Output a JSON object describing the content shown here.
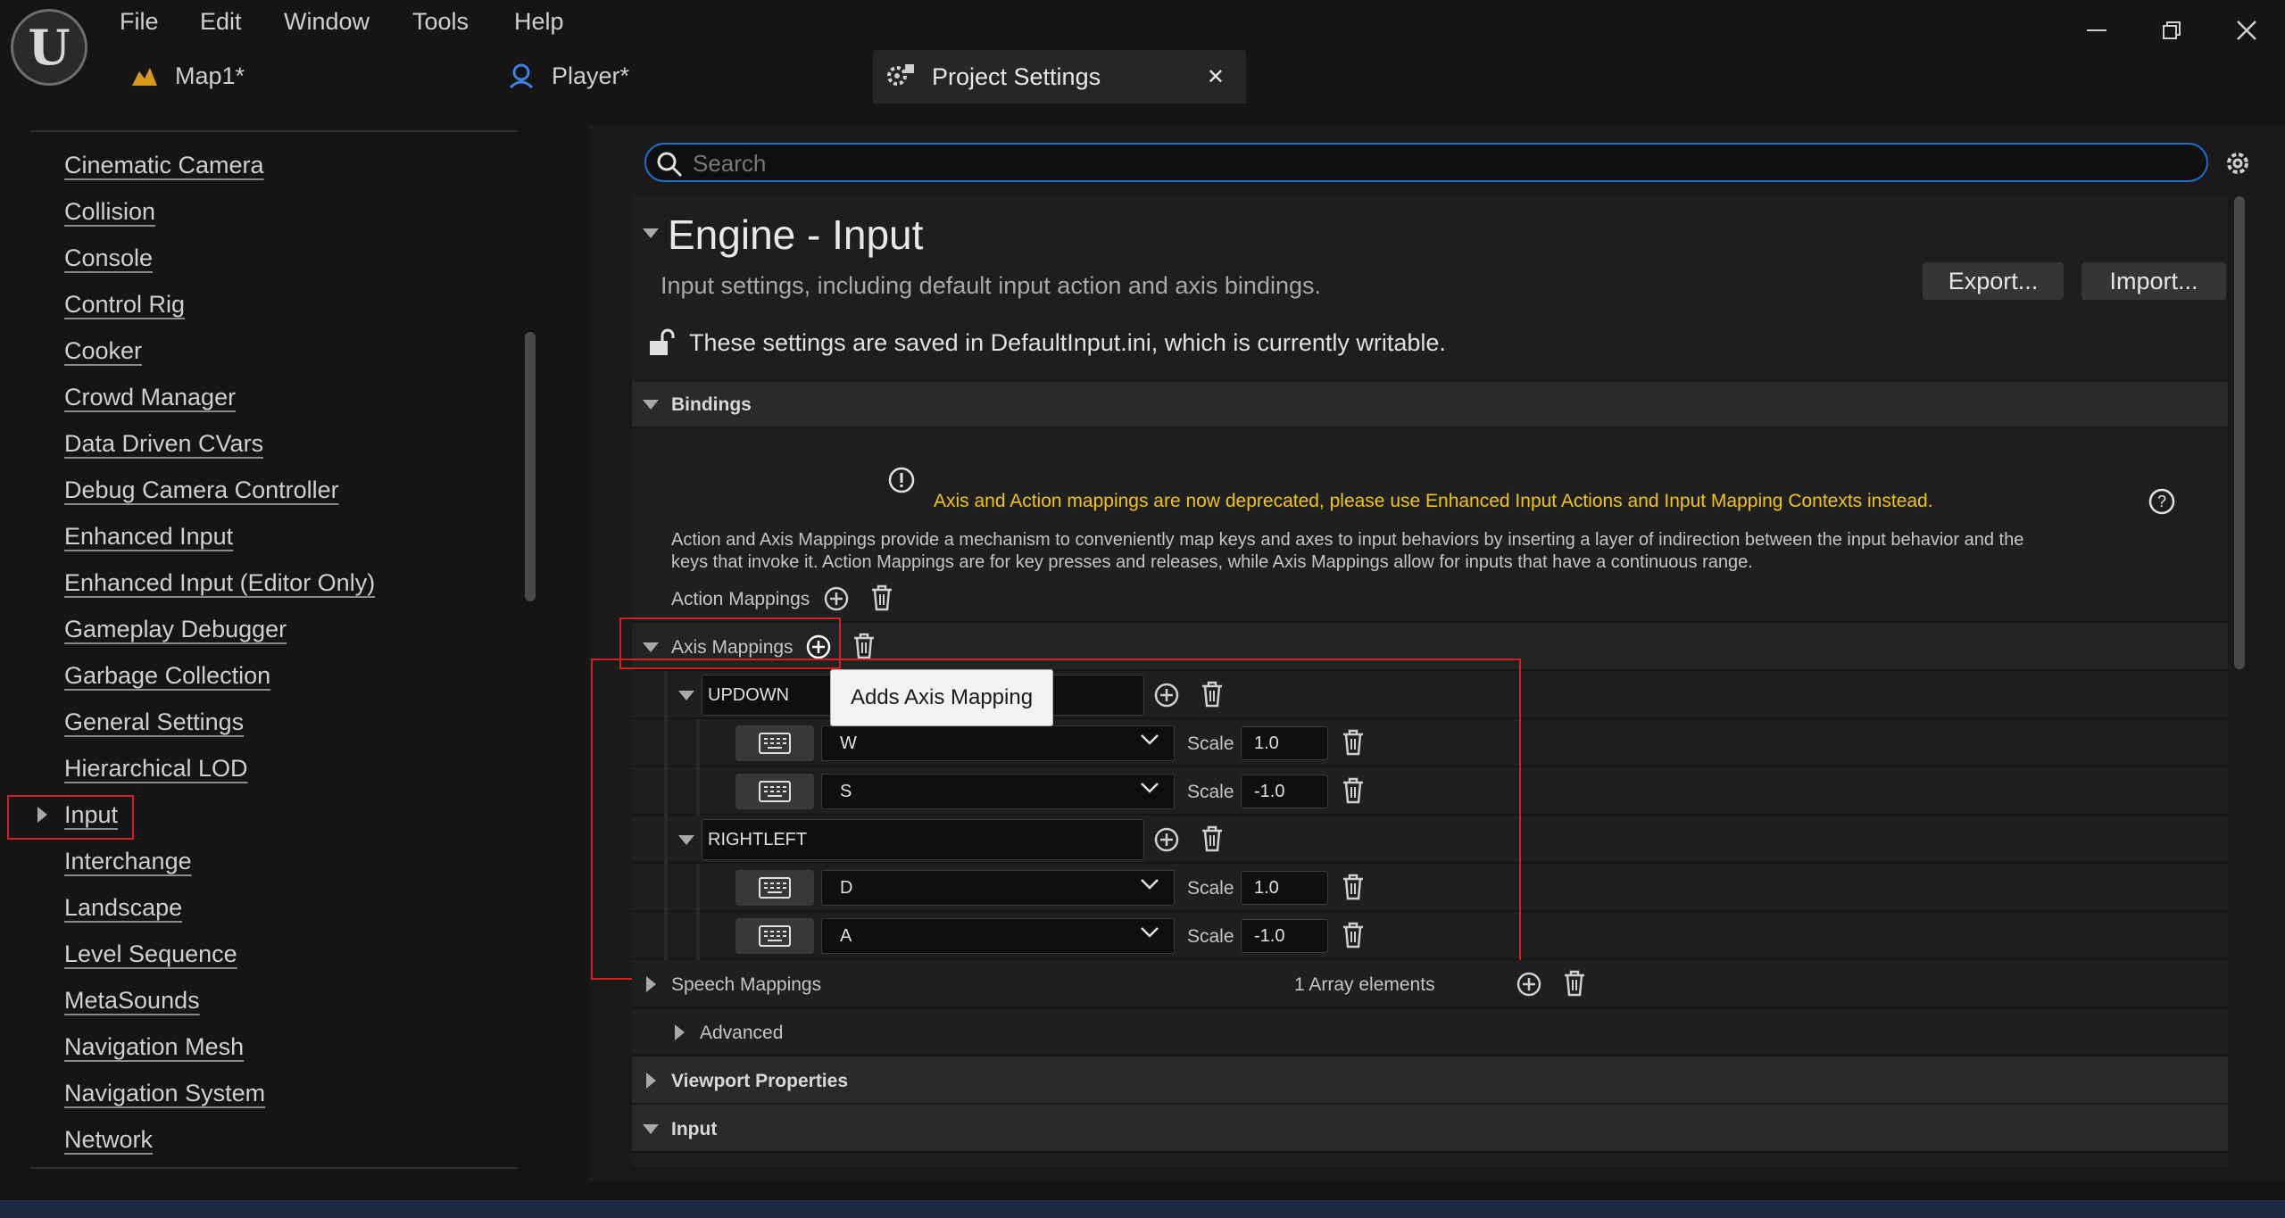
{
  "menu": [
    "File",
    "Edit",
    "Window",
    "Tools",
    "Help"
  ],
  "tabs": {
    "map": "Map1*",
    "player": "Player*",
    "project": "Project Settings"
  },
  "nav": {
    "items": [
      "Cinematic Camera",
      "Collision",
      "Console",
      "Control Rig",
      "Cooker",
      "Crowd Manager",
      "Data Driven CVars",
      "Debug Camera Controller",
      "Enhanced Input",
      "Enhanced Input (Editor Only)",
      "Gameplay Debugger",
      "Garbage Collection",
      "General Settings",
      "Hierarchical LOD",
      "Input",
      "Interchange",
      "Landscape",
      "Level Sequence",
      "MetaSounds",
      "Navigation Mesh",
      "Navigation System",
      "Network"
    ],
    "selected": "Input"
  },
  "search": {
    "placeholder": "Search"
  },
  "header": {
    "title": "Engine - Input",
    "subtitle": "Input settings, including default input action and axis bindings.",
    "export": "Export...",
    "import": "Import...",
    "writable": "These settings are saved in DefaultInput.ini, which is currently writable."
  },
  "bindings": {
    "label": "Bindings",
    "warning": "Axis and Action mappings are now deprecated, please use Enhanced Input Actions and Input Mapping Contexts instead.",
    "description_line1": "Action and Axis Mappings provide a mechanism to conveniently map keys and axes to input behaviors by inserting a layer of indirection between the input behavior and the",
    "description_line2": "keys that invoke it. Action Mappings are for key presses and releases, while Axis Mappings allow for inputs that have a continuous range.",
    "action_mappings": "Action Mappings",
    "axis_mappings": "Axis Mappings",
    "tooltip": "Adds Axis Mapping",
    "scale_label": "Scale",
    "axes": [
      {
        "name": "UPDOWN",
        "keys": [
          {
            "key": "W",
            "scale": "1.0"
          },
          {
            "key": "S",
            "scale": "-1.0"
          }
        ]
      },
      {
        "name": "RIGHTLEFT",
        "keys": [
          {
            "key": "D",
            "scale": "1.0"
          },
          {
            "key": "A",
            "scale": "-1.0"
          }
        ]
      }
    ],
    "speech_mappings": "Speech Mappings",
    "speech_count": "1 Array elements",
    "advanced": "Advanced"
  },
  "sections": {
    "viewport": "Viewport Properties",
    "input": "Input"
  },
  "colors": {
    "accent": "#1e6fd4",
    "warning": "#f0c419",
    "highlight": "#d21f1f"
  }
}
